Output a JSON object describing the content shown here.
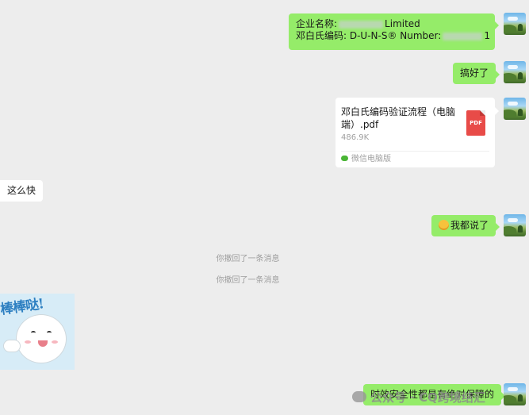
{
  "messages": {
    "msg1": {
      "line1_prefix": "企业名称:",
      "line1_suffix": "Limited",
      "line2_prefix": "邓白氏编码: D-U-N-S® Number:",
      "line2_suffix": "1"
    },
    "msg2": {
      "text": "搞好了"
    },
    "file": {
      "name": "邓白氏编码验证流程（电脑端）.pdf",
      "size": "486.9K",
      "icon_label": "PDF",
      "source": "微信电脑版"
    },
    "msg3": {
      "text": "这么快"
    },
    "msg4": {
      "text": "我都说了"
    },
    "system1": "你撤回了一条消息",
    "system2": "你撤回了一条消息",
    "sticker": {
      "text": "棒棒哒!"
    },
    "msg5": {
      "text": "时效安全性都是有绝对保障的"
    }
  },
  "watermark": {
    "text": "公众号 · CQ跨境结汇"
  }
}
